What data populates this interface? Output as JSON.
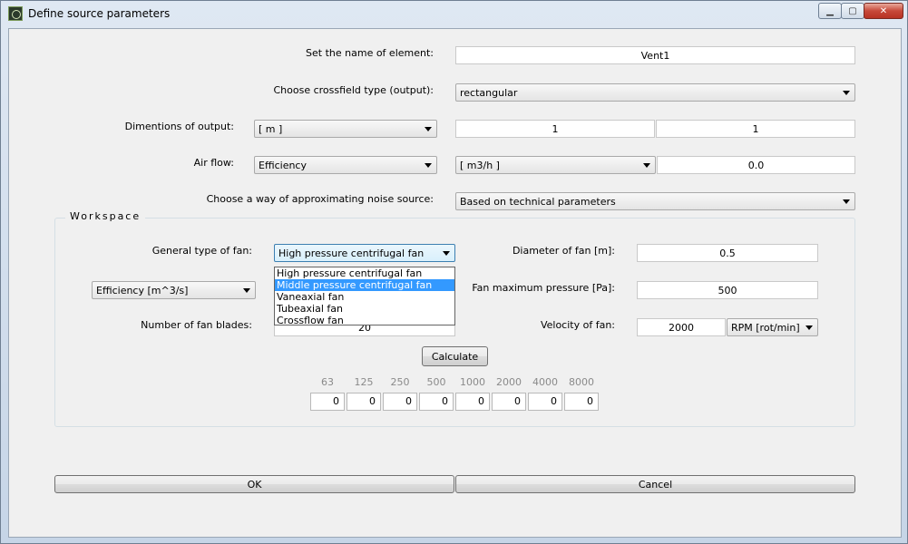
{
  "window": {
    "title": "Define source parameters",
    "min": "▁",
    "max": "▢",
    "close": "✕"
  },
  "form": {
    "name_label": "Set the name of element:",
    "name_value": "Vent1",
    "crossfield_label": "Choose crossfield type (output):",
    "crossfield_value": "rectangular",
    "dimensions_label": "Dimentions of output:",
    "dimensions_unit": "[ m ]",
    "dim_a": "1",
    "dim_b": "1",
    "airflow_label": "Air flow:",
    "airflow_type": "Efficiency",
    "airflow_unit": "[ m3/h ]",
    "airflow_value": "0.0",
    "approx_label": "Choose a way of approximating noise source:",
    "approx_value": "Based on technical parameters"
  },
  "workspace": {
    "title": "Workspace",
    "fan_type_label": "General type of fan:",
    "fan_type_value": "High pressure centrifugal fan",
    "fan_type_options": [
      "High pressure centrifugal fan",
      "Middle pressure centrifugal fan",
      "Vaneaxial fan",
      "Tubeaxial fan",
      "Crossflow fan"
    ],
    "efficiency_combo": "Efficiency [m^3/s]",
    "blades_label": "Number of fan blades:",
    "blades_value": "20",
    "diameter_label": "Diameter of fan [m]:",
    "diameter_value": "0.5",
    "pressure_label": "Fan maximum pressure [Pa]:",
    "pressure_value": "500",
    "velocity_label": "Velocity of fan:",
    "velocity_value": "2000",
    "velocity_unit": "RPM [rot/min]",
    "calculate_label": "Calculate",
    "frequencies": [
      "63",
      "125",
      "250",
      "500",
      "1000",
      "2000",
      "4000",
      "8000"
    ],
    "levels": [
      "0",
      "0",
      "0",
      "0",
      "0",
      "0",
      "0",
      "0"
    ]
  },
  "buttons": {
    "ok": "OK",
    "cancel": "Cancel"
  }
}
